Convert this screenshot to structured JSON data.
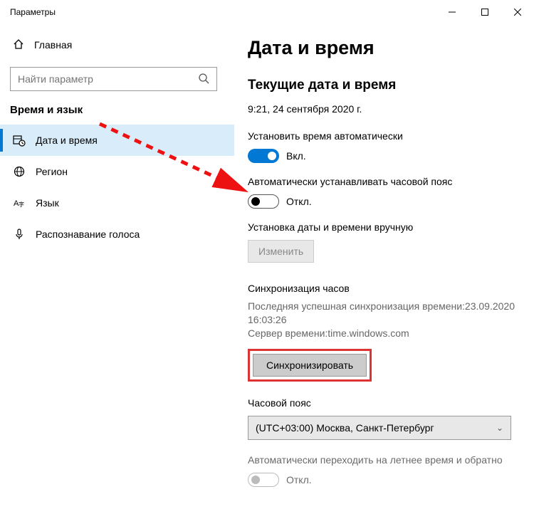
{
  "window": {
    "title": "Параметры"
  },
  "sidebar": {
    "home": "Главная",
    "search_placeholder": "Найти параметр",
    "category": "Время и язык",
    "items": [
      {
        "label": "Дата и время"
      },
      {
        "label": "Регион"
      },
      {
        "label": "Язык"
      },
      {
        "label": "Распознавание голоса"
      }
    ]
  },
  "content": {
    "title": "Дата и время",
    "current_heading": "Текущие дата и время",
    "current_datetime": "9:21, 24 сентября 2020 г.",
    "auto_time_label": "Установить время автоматически",
    "toggle_on": "Вкл.",
    "toggle_off": "Откл.",
    "auto_tz_label": "Автоматически устанавливать часовой пояс",
    "manual_set_label": "Установка даты и времени вручную",
    "change_btn": "Изменить",
    "sync_heading": "Синхронизация часов",
    "sync_last": "Последняя успешная синхронизация времени:23.09.2020 16:03:26",
    "sync_server": "Сервер времени:time.windows.com",
    "sync_btn": "Синхронизировать",
    "tz_heading": "Часовой пояс",
    "tz_value": "(UTC+03:00) Москва, Санкт-Петербург",
    "dst_label": "Автоматически переходить на летнее время и обратно"
  }
}
